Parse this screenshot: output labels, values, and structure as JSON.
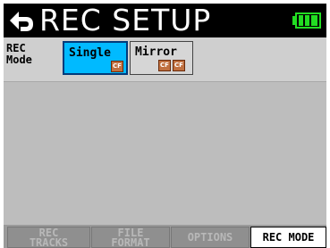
{
  "title": "REC SETUP",
  "header": {
    "back_icon": "back-arrow-icon",
    "battery_icon": "battery-full-icon",
    "battery_color": "#22dd22"
  },
  "rec_mode": {
    "label": "REC\nMode",
    "options": [
      {
        "label": "Single",
        "selected": true,
        "icon": "cf-card-icon"
      },
      {
        "label": "Mirror",
        "selected": false,
        "icon": "cf-card-icon"
      }
    ],
    "cf_text": "CF"
  },
  "tabs": [
    {
      "label": "REC\nTRACKS",
      "active": false
    },
    {
      "label": "FILE\nFORMAT",
      "active": false
    },
    {
      "label": "OPTIONS",
      "active": false
    },
    {
      "label": "REC MODE",
      "active": true
    }
  ],
  "colors": {
    "selected_button": "#00baff",
    "title_bar": "#000000",
    "content_bg": "#bdbdbd"
  }
}
